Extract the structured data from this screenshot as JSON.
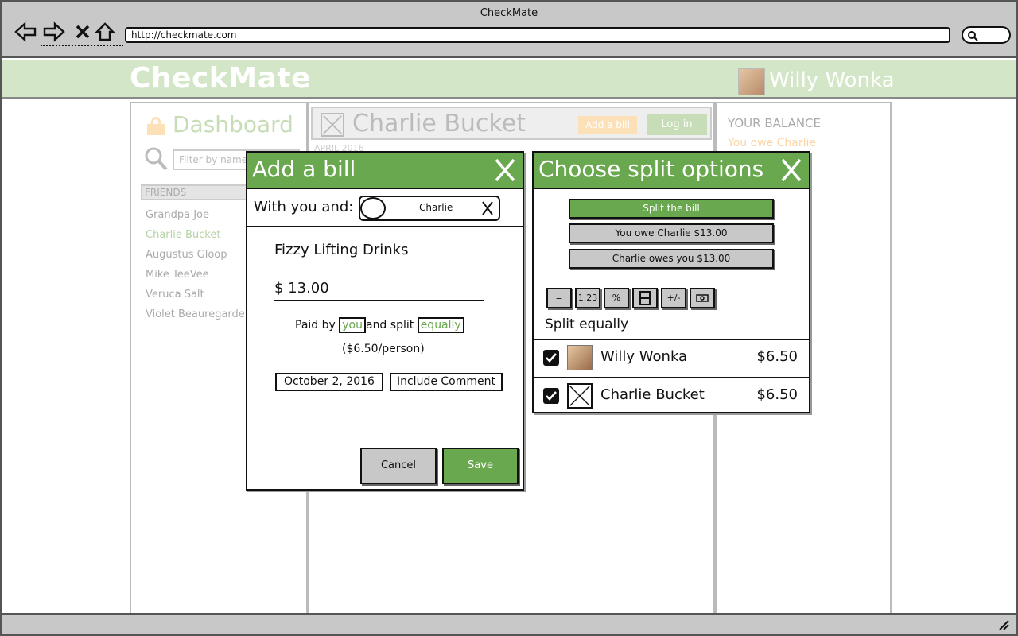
{
  "window": {
    "title": "CheckMate",
    "url": "http://checkmate.com"
  },
  "app": {
    "logo": "CheckMate",
    "user_name": "Willy Wonka"
  },
  "sidebar": {
    "title": "Dashboard",
    "filter_placeholder": "Filter by name",
    "friends_header": "FRIENDS",
    "friends": [
      "Grandpa Joe",
      "Charlie Bucket",
      "Augustus Gloop",
      "Mike TeeVee",
      "Veruca Salt",
      "Violet Beauregarde"
    ],
    "active_friend_index": 1
  },
  "center": {
    "friend_name": "Charlie Bucket",
    "add_bill_label": "Add a bill",
    "login_label": "Log in",
    "date_header": "APRIL 2016"
  },
  "balance": {
    "label": "YOUR BALANCE",
    "note": "You owe Charlie"
  },
  "add_bill_modal": {
    "title": "Add a bill",
    "close_glyph": "X",
    "with_label": "With you and:",
    "with_person": "Charlie",
    "description": "Fizzy Lifting Drinks",
    "amount": "$ 13.00",
    "paid_by_prefix": "Paid by",
    "paid_by": "you",
    "split_prefix": "and split",
    "split_mode": "equally",
    "per_person": "($6.50/person)",
    "date": "October 2, 2016",
    "comment_label": "Include Comment",
    "cancel_label": "Cancel",
    "save_label": "Save"
  },
  "split_modal": {
    "title": "Choose split options",
    "close_glyph": "X",
    "options": [
      "Split the bill",
      "You owe Charlie $13.00",
      "Charlie owes you $13.00"
    ],
    "type_buttons": [
      "=",
      "1.23",
      "%",
      "",
      "+/-",
      ""
    ],
    "mode_label": "Split equally",
    "rows": [
      {
        "name": "Willy Wonka",
        "amount": "$6.50",
        "checked": true
      },
      {
        "name": "Charlie Bucket",
        "amount": "$6.50",
        "checked": true
      }
    ]
  },
  "colors": {
    "accent_green": "#6aa84f",
    "header_green": "#d4e6c8",
    "faded_orange": "#fbd5a4"
  }
}
